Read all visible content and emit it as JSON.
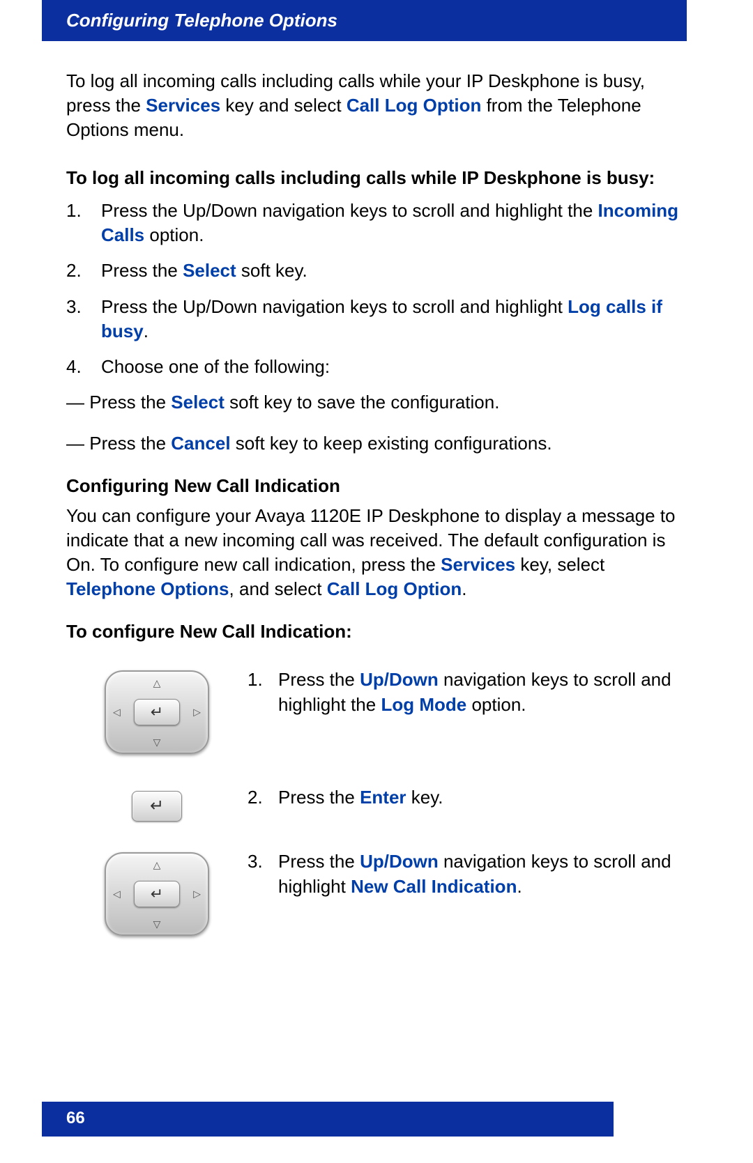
{
  "header": {
    "title": "Configuring Telephone Options"
  },
  "intro": {
    "pre": "To log all incoming calls including calls while your IP Deskphone is busy, press the ",
    "hl1": "Services",
    "mid1": " key and select ",
    "hl2": "Call Log Option",
    "post": " from the Telephone Options menu."
  },
  "bold_heading": "To log all incoming calls including calls while IP Deskphone is busy:",
  "steps_a": [
    {
      "pre": "Press the Up/Down navigation keys to scroll and highlight the ",
      "hl": "Incoming Calls",
      "post": " option."
    },
    {
      "pre": "Press the ",
      "hl": "Select",
      "post": " soft key."
    },
    {
      "pre": "Press the Up/Down navigation keys to scroll and highlight ",
      "hl": "Log calls if busy",
      "post": "."
    },
    {
      "pre": "Choose one of the following:",
      "hl": "",
      "post": ""
    }
  ],
  "dash1": {
    "pre": "— Press the ",
    "hl": "Select",
    "post": " soft key to save the configuration."
  },
  "dash2": {
    "pre": "— Press the ",
    "hl": "Cancel",
    "post": " soft key to keep existing configurations."
  },
  "sub_heading": "Configuring New Call Indication",
  "body_para": {
    "pre": "You can configure your Avaya 1120E IP Deskphone to display a message to indicate that a new incoming call was received. The default configuration is On. To configure new call indication, press the ",
    "hl1": "Services",
    "mid1": " key, select ",
    "hl2": "Telephone Options",
    "mid2": ", and select ",
    "hl3": "Call Log Option",
    "post": "."
  },
  "bold_heading2": "To configure New Call Indication:",
  "steps_b": [
    {
      "num": "1.",
      "pre": "Press the ",
      "hl1": "Up/Down",
      "mid": " navigation keys to scroll and highlight the ",
      "hl2": "Log Mode",
      "post": " option."
    },
    {
      "num": "2.",
      "pre": "Press the ",
      "hl1": "Enter",
      "mid": "",
      "hl2": "",
      "post": " key."
    },
    {
      "num": "3.",
      "pre": "Press the ",
      "hl1": "Up/Down",
      "mid": " navigation keys to scroll and highlight ",
      "hl2": "New Call Indication",
      "post": "."
    }
  ],
  "footer": {
    "page_num": "66"
  }
}
